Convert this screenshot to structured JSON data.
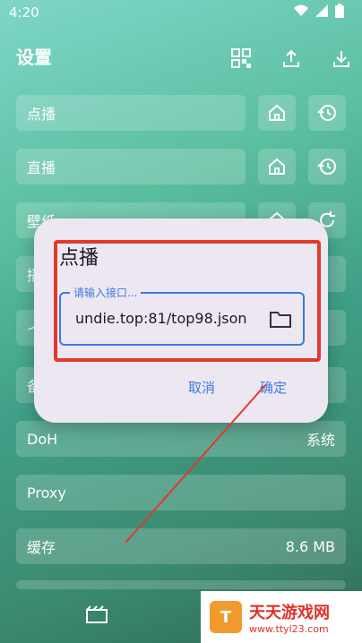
{
  "status": {
    "time": "4:20"
  },
  "header": {
    "title": "设置"
  },
  "rows": [
    {
      "label": "点播"
    },
    {
      "label": "直播"
    },
    {
      "label": "壁纸"
    },
    {
      "label": "播"
    },
    {
      "label": "イ"
    },
    {
      "label": "备"
    },
    {
      "label": "DoH",
      "value": "系统"
    },
    {
      "label": "Proxy"
    },
    {
      "label": "缓存",
      "value": "8.6 MB"
    }
  ],
  "dialog": {
    "title": "点播",
    "field_label": "请输入接口...",
    "field_value": "undie.top:81/top98.json",
    "cancel": "取消",
    "confirm": "确定"
  },
  "watermark": {
    "title": "天天游戏网",
    "url": "www.ttyl23.com",
    "logo": "T"
  },
  "colors": {
    "accent": "#3a7bdc",
    "highlight": "#e03a2a"
  }
}
